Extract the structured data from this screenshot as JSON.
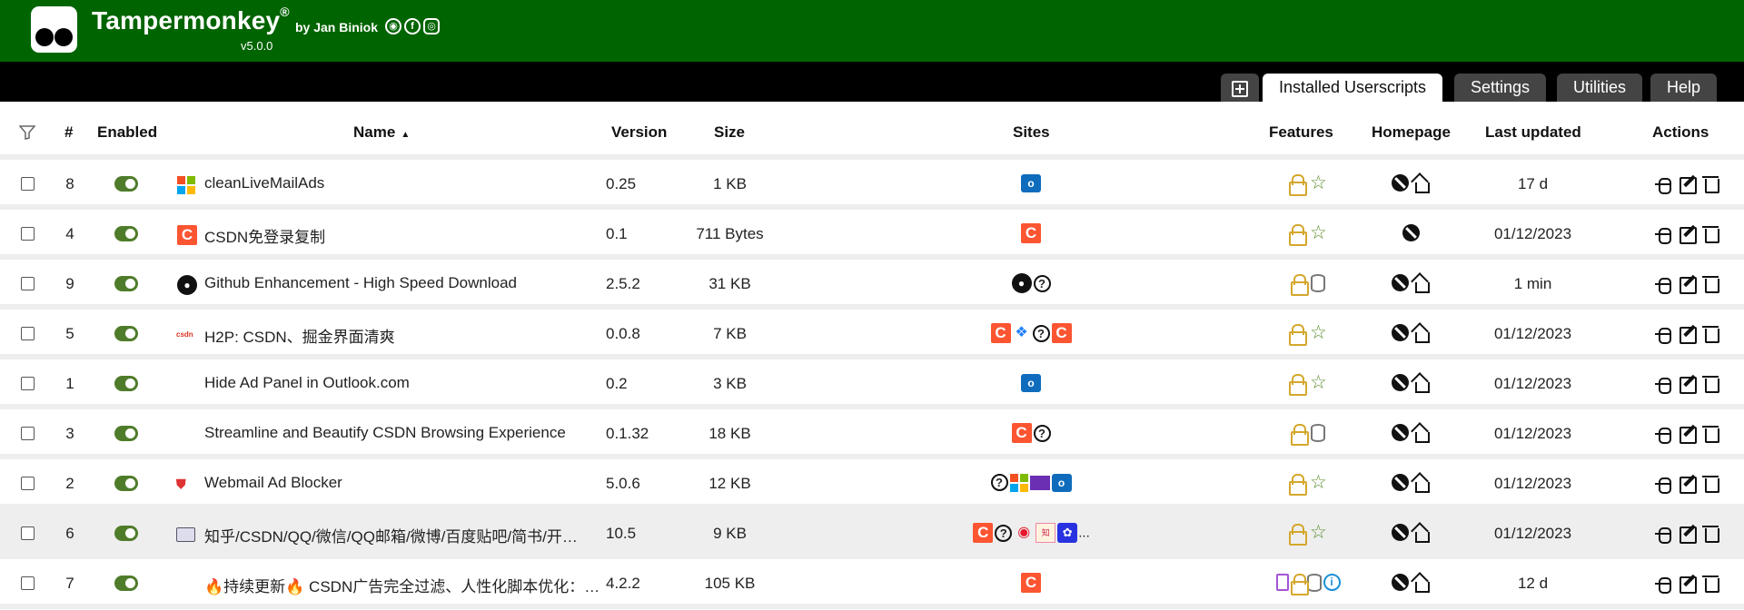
{
  "header": {
    "title": "Tampermonkey",
    "registered_mark": "®",
    "version": "v5.0.0",
    "byline": "by Jan Biniok",
    "social_icons": [
      "github-icon",
      "facebook-icon",
      "instagram-icon"
    ],
    "brand_color": "#006400"
  },
  "tabs": {
    "new_script_icon": "plus-box-icon",
    "items": [
      {
        "label": "Installed Userscripts",
        "active": true
      },
      {
        "label": "Settings",
        "active": false
      },
      {
        "label": "Utilities",
        "active": false
      },
      {
        "label": "Help",
        "active": false
      }
    ]
  },
  "table": {
    "columns": {
      "filter_icon": "filter-icon",
      "num": "#",
      "enabled": "Enabled",
      "name": "Name",
      "name_sort": "▲",
      "version": "Version",
      "size": "Size",
      "sites": "Sites",
      "features": "Features",
      "homepage": "Homepage",
      "last_updated": "Last updated",
      "actions": "Actions"
    },
    "rows": [
      {
        "num": "8",
        "enabled": true,
        "name": "cleanLiveMailAds",
        "version": "0.25",
        "size": "1 KB",
        "updated": "17 d",
        "sites": [
          "outlook"
        ],
        "features": [
          "lock",
          "star"
        ],
        "homepage": [
          "homepage",
          "home"
        ],
        "icon": "microsoft"
      },
      {
        "num": "4",
        "enabled": true,
        "name": "CSDN免登录复制",
        "version": "0.1",
        "size": "711 Bytes",
        "updated": "01/12/2023",
        "sites": [
          "csdn"
        ],
        "features": [
          "lock",
          "star"
        ],
        "homepage": [
          "homepage"
        ],
        "icon": "csdn"
      },
      {
        "num": "9",
        "enabled": true,
        "name": "Github Enhancement - High Speed Download",
        "version": "2.5.2",
        "size": "31 KB",
        "updated": "1 min",
        "sites": [
          "github",
          "unknown"
        ],
        "features": [
          "lock",
          "db"
        ],
        "homepage": [
          "homepage",
          "home"
        ],
        "icon": "github"
      },
      {
        "num": "5",
        "enabled": true,
        "name": "H2P: CSDN、掘金界面清爽",
        "version": "0.0.8",
        "size": "7 KB",
        "updated": "01/12/2023",
        "sites": [
          "csdn",
          "juejin",
          "unknown",
          "csdn"
        ],
        "features": [
          "lock",
          "star"
        ],
        "homepage": [
          "homepage",
          "home"
        ],
        "icon": "csdn-text"
      },
      {
        "num": "1",
        "enabled": true,
        "name": "Hide Ad Panel in Outlook.com",
        "version": "0.2",
        "size": "3 KB",
        "updated": "01/12/2023",
        "sites": [
          "outlook"
        ],
        "features": [
          "lock",
          "star"
        ],
        "homepage": [
          "homepage",
          "home"
        ],
        "icon": ""
      },
      {
        "num": "3",
        "enabled": true,
        "name": "Streamline and Beautify CSDN Browsing Experience",
        "version": "0.1.32",
        "size": "18 KB",
        "updated": "01/12/2023",
        "sites": [
          "csdn",
          "unknown"
        ],
        "features": [
          "lock",
          "db"
        ],
        "homepage": [
          "homepage",
          "home"
        ],
        "icon": ""
      },
      {
        "num": "2",
        "enabled": true,
        "name": "Webmail Ad Blocker",
        "version": "5.0.6",
        "size": "12 KB",
        "updated": "01/12/2023",
        "sites": [
          "unknown",
          "microsoft",
          "mail",
          "outlook"
        ],
        "features": [
          "lock",
          "star"
        ],
        "homepage": [
          "homepage",
          "home"
        ],
        "icon": "shield"
      },
      {
        "num": "6",
        "enabled": true,
        "name": "知乎/CSDN/QQ/微信/QQ邮箱/微博/百度贴吧/简书/开…",
        "version": "10.5",
        "size": "9 KB",
        "updated": "01/12/2023",
        "sites": [
          "csdn",
          "unknown",
          "weibo",
          "zhihu",
          "baidu"
        ],
        "sites_more": "...",
        "features": [
          "lock",
          "star"
        ],
        "homepage": [
          "homepage",
          "home"
        ],
        "icon": "window",
        "highlight": true
      },
      {
        "num": "7",
        "enabled": true,
        "name": "🔥持续更新🔥 CSDN广告完全过滤、人性化脚本优化：…",
        "version": "4.2.2",
        "size": "105 KB",
        "updated": "12 d",
        "sites": [
          "csdn"
        ],
        "features": [
          "file",
          "lock",
          "db",
          "info"
        ],
        "homepage": [
          "homepage",
          "home"
        ],
        "icon": ""
      }
    ],
    "actions": [
      "bug-icon",
      "edit-icon",
      "trash-icon"
    ]
  }
}
